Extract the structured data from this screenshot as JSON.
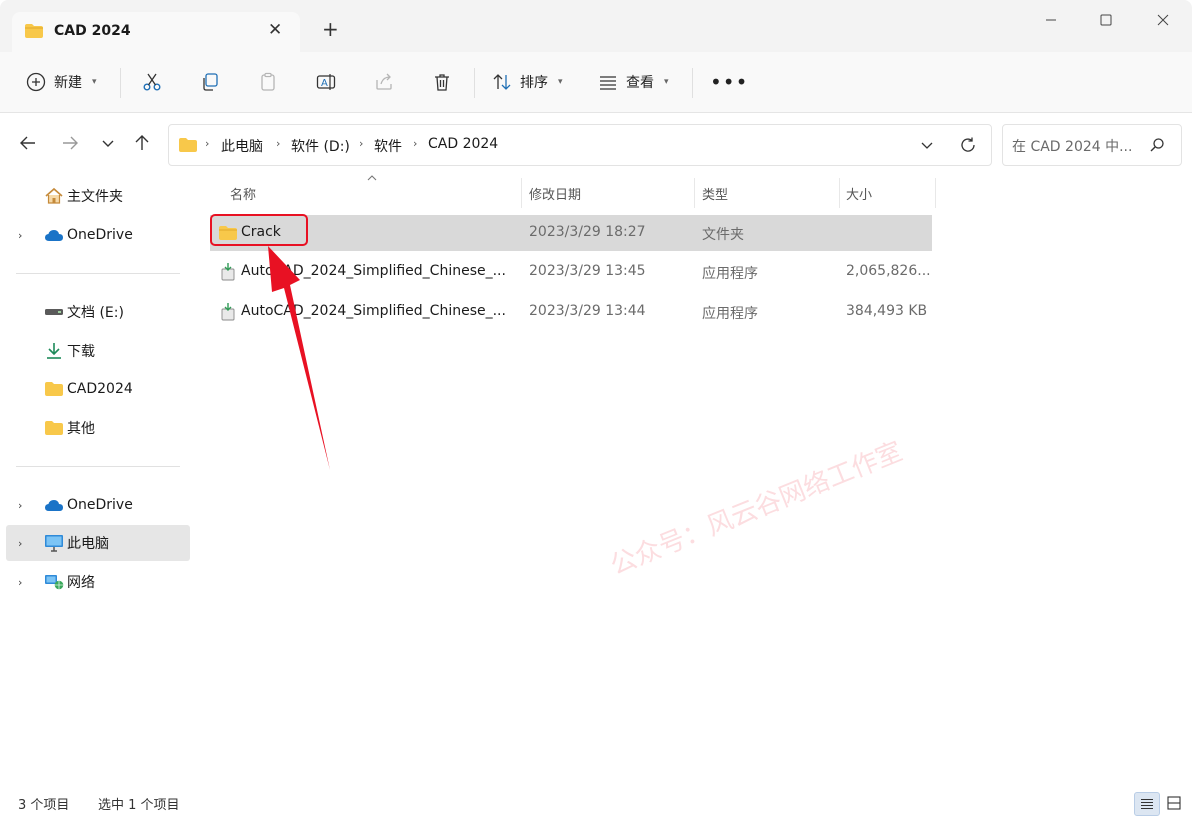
{
  "window": {
    "tab_title": "CAD 2024"
  },
  "toolbar": {
    "new_label": "新建",
    "sort_label": "排序",
    "view_label": "查看"
  },
  "address": {
    "crumbs": [
      "此电脑",
      "软件 (D:)",
      "软件",
      "CAD 2024"
    ],
    "search_placeholder": "在 CAD 2024 中..."
  },
  "sidebar": {
    "items": [
      {
        "label": "主文件夹",
        "icon": "home-icon"
      },
      {
        "label": "OneDrive",
        "icon": "cloud-icon"
      },
      {
        "label": "文档 (E:)",
        "icon": "drive-icon"
      },
      {
        "label": "下载",
        "icon": "download-icon"
      },
      {
        "label": "CAD2024",
        "icon": "folder-icon"
      },
      {
        "label": "其他",
        "icon": "folder-icon"
      },
      {
        "label": "OneDrive",
        "icon": "cloud-icon"
      },
      {
        "label": "此电脑",
        "icon": "computer-icon"
      },
      {
        "label": "网络",
        "icon": "network-icon"
      }
    ]
  },
  "columns": {
    "name": "名称",
    "date": "修改日期",
    "type": "类型",
    "size": "大小"
  },
  "files": [
    {
      "name": "Crack",
      "date": "2023/3/29 18:27",
      "type": "文件夹",
      "size": ""
    },
    {
      "name": "AutoCAD_2024_Simplified_Chinese_...",
      "date": "2023/3/29 13:45",
      "type": "应用程序",
      "size": "2,065,826..."
    },
    {
      "name": "AutoCAD_2024_Simplified_Chinese_...",
      "date": "2023/3/29 13:44",
      "type": "应用程序",
      "size": "384,493 KB"
    }
  ],
  "status": {
    "count": "3 个项目",
    "selected": "选中 1 个项目"
  },
  "watermark": "公众号：风云谷网络工作室",
  "colors": {
    "accent_red": "#e81123",
    "folder_yellow": "#f8c84a",
    "selection": "#d9d9d9"
  }
}
